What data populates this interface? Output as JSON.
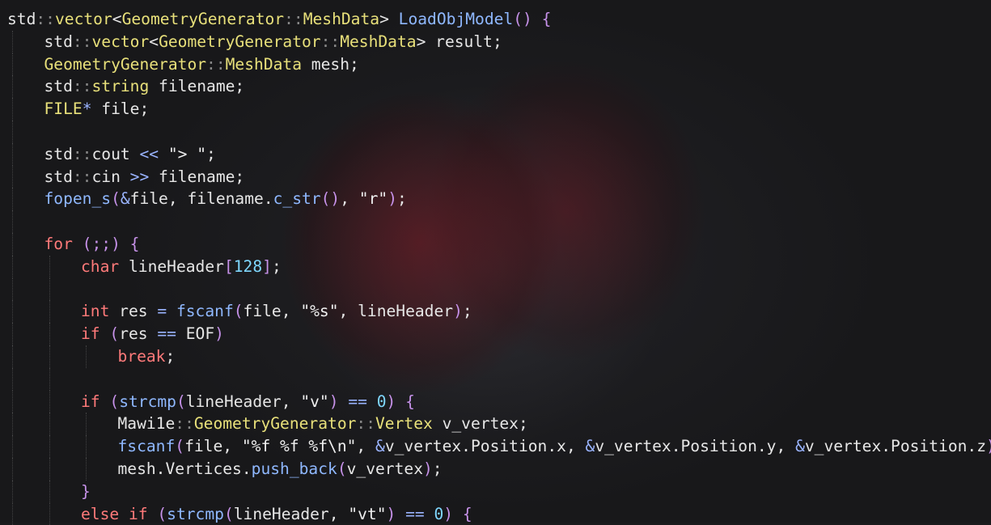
{
  "colors": {
    "plain": "#e6e6e6",
    "keyword": "#ff7a7a",
    "type": "#e8e07a",
    "function": "#8fb8ff",
    "number": "#7fd7ff",
    "operator": "#9ab4ff",
    "scope": "#8a8a8a",
    "background": "#1a1a1c"
  },
  "code_lines": [
    {
      "indent": 0,
      "tokens": [
        [
          "plain",
          "std"
        ],
        [
          "scope",
          "::"
        ],
        [
          "type",
          "vector"
        ],
        [
          "plain",
          "<"
        ],
        [
          "type",
          "GeometryGenerator"
        ],
        [
          "scope",
          "::"
        ],
        [
          "type",
          "MeshData"
        ],
        [
          "plain",
          "> "
        ],
        [
          "fn",
          "LoadObjModel"
        ],
        [
          "kw2",
          "() {"
        ]
      ]
    },
    {
      "indent": 1,
      "tokens": [
        [
          "plain",
          "std"
        ],
        [
          "scope",
          "::"
        ],
        [
          "type",
          "vector"
        ],
        [
          "plain",
          "<"
        ],
        [
          "type",
          "GeometryGenerator"
        ],
        [
          "scope",
          "::"
        ],
        [
          "type",
          "MeshData"
        ],
        [
          "plain",
          "> result;"
        ]
      ]
    },
    {
      "indent": 1,
      "tokens": [
        [
          "type",
          "GeometryGenerator"
        ],
        [
          "scope",
          "::"
        ],
        [
          "type",
          "MeshData"
        ],
        [
          "plain",
          " mesh;"
        ]
      ]
    },
    {
      "indent": 1,
      "tokens": [
        [
          "plain",
          "std"
        ],
        [
          "scope",
          "::"
        ],
        [
          "type",
          "string"
        ],
        [
          "plain",
          " filename;"
        ]
      ]
    },
    {
      "indent": 1,
      "tokens": [
        [
          "type",
          "FILE"
        ],
        [
          "op",
          "*"
        ],
        [
          "plain",
          " file;"
        ]
      ]
    },
    {
      "indent": 1,
      "tokens": []
    },
    {
      "indent": 1,
      "tokens": [
        [
          "plain",
          "std"
        ],
        [
          "scope",
          "::"
        ],
        [
          "plain",
          "cout "
        ],
        [
          "op",
          "<<"
        ],
        [
          "str",
          " \"> \""
        ],
        [
          "plain",
          ";"
        ]
      ]
    },
    {
      "indent": 1,
      "tokens": [
        [
          "plain",
          "std"
        ],
        [
          "scope",
          "::"
        ],
        [
          "plain",
          "cin "
        ],
        [
          "op",
          ">>"
        ],
        [
          "plain",
          " filename;"
        ]
      ]
    },
    {
      "indent": 1,
      "tokens": [
        [
          "fn",
          "fopen_s"
        ],
        [
          "kw2",
          "("
        ],
        [
          "op",
          "&"
        ],
        [
          "plain",
          "file, filename."
        ],
        [
          "fn",
          "c_str"
        ],
        [
          "kw2",
          "()"
        ],
        [
          "plain",
          ", "
        ],
        [
          "str",
          "\"r\""
        ],
        [
          "kw2",
          ")"
        ],
        [
          "plain",
          ";"
        ]
      ]
    },
    {
      "indent": 1,
      "tokens": []
    },
    {
      "indent": 1,
      "tokens": [
        [
          "kw",
          "for"
        ],
        [
          "kw2",
          " (;;) {"
        ]
      ]
    },
    {
      "indent": 2,
      "tokens": [
        [
          "kw",
          "char"
        ],
        [
          "plain",
          " lineHeader"
        ],
        [
          "kw2",
          "["
        ],
        [
          "num",
          "128"
        ],
        [
          "kw2",
          "]"
        ],
        [
          "plain",
          ";"
        ]
      ]
    },
    {
      "indent": 2,
      "tokens": []
    },
    {
      "indent": 2,
      "tokens": [
        [
          "kw",
          "int"
        ],
        [
          "plain",
          " res "
        ],
        [
          "op",
          "="
        ],
        [
          "plain",
          " "
        ],
        [
          "fn",
          "fscanf"
        ],
        [
          "kw2",
          "("
        ],
        [
          "plain",
          "file, "
        ],
        [
          "str",
          "\"%s\""
        ],
        [
          "plain",
          ", lineHeader"
        ],
        [
          "kw2",
          ")"
        ],
        [
          "plain",
          ";"
        ]
      ]
    },
    {
      "indent": 2,
      "tokens": [
        [
          "kw",
          "if"
        ],
        [
          "kw2",
          " ("
        ],
        [
          "plain",
          "res "
        ],
        [
          "op",
          "=="
        ],
        [
          "plain",
          " EOF"
        ],
        [
          "kw2",
          ")"
        ]
      ]
    },
    {
      "indent": 3,
      "tokens": [
        [
          "kw",
          "break"
        ],
        [
          "plain",
          ";"
        ]
      ]
    },
    {
      "indent": 2,
      "tokens": []
    },
    {
      "indent": 2,
      "tokens": [
        [
          "kw",
          "if"
        ],
        [
          "kw2",
          " ("
        ],
        [
          "fn",
          "strcmp"
        ],
        [
          "kw2",
          "("
        ],
        [
          "plain",
          "lineHeader, "
        ],
        [
          "str",
          "\"v\""
        ],
        [
          "kw2",
          ")"
        ],
        [
          "plain",
          " "
        ],
        [
          "op",
          "=="
        ],
        [
          "plain",
          " "
        ],
        [
          "num",
          "0"
        ],
        [
          "kw2",
          ") {"
        ]
      ]
    },
    {
      "indent": 3,
      "tokens": [
        [
          "plain",
          "Mawi1e"
        ],
        [
          "scope",
          "::"
        ],
        [
          "type",
          "GeometryGenerator"
        ],
        [
          "scope",
          "::"
        ],
        [
          "type",
          "Vertex"
        ],
        [
          "plain",
          " v_vertex;"
        ]
      ]
    },
    {
      "indent": 3,
      "tokens": [
        [
          "fn",
          "fscanf"
        ],
        [
          "kw2",
          "("
        ],
        [
          "plain",
          "file, "
        ],
        [
          "str",
          "\"%f %f %f\\n\""
        ],
        [
          "plain",
          ", "
        ],
        [
          "op",
          "&"
        ],
        [
          "plain",
          "v_vertex.Position.x, "
        ],
        [
          "op",
          "&"
        ],
        [
          "plain",
          "v_vertex.Position.y, "
        ],
        [
          "op",
          "&"
        ],
        [
          "plain",
          "v_vertex.Position.z"
        ],
        [
          "kw2",
          ")"
        ],
        [
          "plain",
          ";"
        ]
      ]
    },
    {
      "indent": 3,
      "tokens": [
        [
          "plain",
          "mesh.Vertices."
        ],
        [
          "fn",
          "push_back"
        ],
        [
          "kw2",
          "("
        ],
        [
          "plain",
          "v_vertex"
        ],
        [
          "kw2",
          ")"
        ],
        [
          "plain",
          ";"
        ]
      ]
    },
    {
      "indent": 2,
      "tokens": [
        [
          "kw2",
          "}"
        ]
      ]
    },
    {
      "indent": 2,
      "tokens": [
        [
          "kw",
          "else if"
        ],
        [
          "kw2",
          " ("
        ],
        [
          "fn",
          "strcmp"
        ],
        [
          "kw2",
          "("
        ],
        [
          "plain",
          "lineHeader, "
        ],
        [
          "str",
          "\"vt\""
        ],
        [
          "kw2",
          ")"
        ],
        [
          "plain",
          " "
        ],
        [
          "op",
          "=="
        ],
        [
          "plain",
          " "
        ],
        [
          "num",
          "0"
        ],
        [
          "kw2",
          ") {"
        ]
      ]
    }
  ]
}
